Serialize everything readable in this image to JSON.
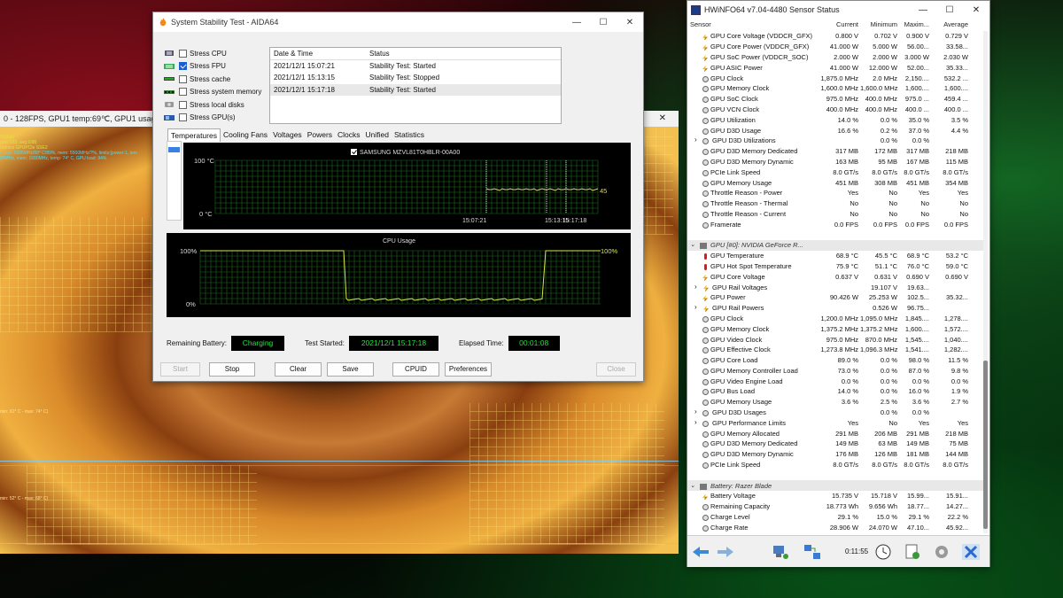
{
  "furmark": {
    "title": "0 - 128FPS, GPU1 temp:69℃, GPU1 usage:",
    "osd": [
      "MSAA)",
      "max:133, avg:108)",
      "raphics GPUPCIe SSE2",
      "- core: 1695MHz/68° C/89%, mem: 5500MHz/?%, limits:[power:1, tem",
      "88MHz, mem: 1680MHz, temp: 74° C, GPU load: 94%"
    ],
    "overlay_labels": [
      "min: 61° C - max: 74° C)",
      "min: 52° C - max: 68° C)"
    ]
  },
  "aida": {
    "title": "System Stability Test - AIDA64",
    "window_controls": [
      "—",
      "☐",
      "✕"
    ],
    "stress_items": [
      {
        "label": "Stress CPU",
        "checked": false
      },
      {
        "label": "Stress FPU",
        "checked": true
      },
      {
        "label": "Stress cache",
        "checked": false
      },
      {
        "label": "Stress system memory",
        "checked": false
      },
      {
        "label": "Stress local disks",
        "checked": false
      },
      {
        "label": "Stress GPU(s)",
        "checked": false
      }
    ],
    "log_headers": [
      "Date & Time",
      "Status"
    ],
    "log_rows": [
      {
        "time": "2021/12/1 15:07:21",
        "status": "Stability Test: Started"
      },
      {
        "time": "2021/12/1 15:13:15",
        "status": "Stability Test: Stopped"
      },
      {
        "time": "2021/12/1 15:17:18",
        "status": "Stability Test: Started"
      }
    ],
    "tabs": [
      "Temperatures",
      "Cooling Fans",
      "Voltages",
      "Powers",
      "Clocks",
      "Unified",
      "Statistics"
    ],
    "temp_graph": {
      "legend": "SAMSUNG MZVL81T0HBLR-00A00",
      "y_max_label": "100 °C",
      "y_min_label": "0 °C",
      "x_labels": [
        "15:07:21",
        "15:13:15",
        "15:17:18"
      ],
      "current_value": "45",
      "value": 45
    },
    "cpu_graph": {
      "title": "CPU Usage",
      "y_max_label": "100%",
      "y_min_label": "0%",
      "current_value": "100%"
    },
    "status": {
      "battery_label": "Remaining Battery:",
      "battery_value": "Charging",
      "started_label": "Test Started:",
      "started_value": "2021/12/1 15:17:18",
      "elapsed_label": "Elapsed Time:",
      "elapsed_value": "00:01:08"
    },
    "buttons": {
      "start": "Start",
      "stop": "Stop",
      "clear": "Clear",
      "save": "Save",
      "cpuid": "CPUID",
      "preferences": "Preferences",
      "close": "Close"
    }
  },
  "hwinfo": {
    "title": "HWiNFO64 v7.04-4480 Sensor Status",
    "window_controls": [
      "—",
      "☐",
      "✕"
    ],
    "headers": [
      "Sensor",
      "Current",
      "Minimum",
      "Maxim...",
      "Average"
    ],
    "rows": [
      {
        "icon": "bolt",
        "name": "GPU Core Voltage (VDDCR_GFX)",
        "cur": "0.800 V",
        "min": "0.702 V",
        "max": "0.900 V",
        "avg": "0.729 V"
      },
      {
        "icon": "bolt",
        "name": "GPU Core Power (VDDCR_GFX)",
        "cur": "41.000 W",
        "min": "5.000 W",
        "max": "56.00...",
        "avg": "33.58..."
      },
      {
        "icon": "bolt",
        "name": "GPU SoC Power (VDDCR_SOC)",
        "cur": "2.000 W",
        "min": "2.000 W",
        "max": "3.000 W",
        "avg": "2.030 W"
      },
      {
        "icon": "bolt",
        "name": "GPU ASIC Power",
        "cur": "41.000 W",
        "min": "12.000 W",
        "max": "52.00...",
        "avg": "35.33..."
      },
      {
        "icon": "circle",
        "name": "GPU Clock",
        "cur": "1,875.0 MHz",
        "min": "2.0 MHz",
        "max": "2,150....",
        "avg": "532.2 ..."
      },
      {
        "icon": "circle",
        "name": "GPU Memory Clock",
        "cur": "1,600.0 MHz",
        "min": "1,600.0 MHz",
        "max": "1,600....",
        "avg": "1,600...."
      },
      {
        "icon": "circle",
        "name": "GPU SoC Clock",
        "cur": "975.0 MHz",
        "min": "400.0 MHz",
        "max": "975.0 ...",
        "avg": "459.4 ..."
      },
      {
        "icon": "circle",
        "name": "GPU VCN Clock",
        "cur": "400.0 MHz",
        "min": "400.0 MHz",
        "max": "400.0 ...",
        "avg": "400.0 ..."
      },
      {
        "icon": "circle",
        "name": "GPU Utilization",
        "cur": "14.0 %",
        "min": "0.0 %",
        "max": "35.0 %",
        "avg": "3.5 %"
      },
      {
        "icon": "circle",
        "name": "GPU D3D Usage",
        "cur": "16.6 %",
        "min": "0.2 %",
        "max": "37.0 %",
        "avg": "4.4 %"
      },
      {
        "icon": "expand",
        "name": "GPU D3D Utilizations",
        "cur": "",
        "min": "0.0 %",
        "max": "0.0 %",
        "avg": ""
      },
      {
        "icon": "circle",
        "name": "GPU D3D Memory Dedicated",
        "cur": "317 MB",
        "min": "172 MB",
        "max": "317 MB",
        "avg": "218 MB"
      },
      {
        "icon": "circle",
        "name": "GPU D3D Memory Dynamic",
        "cur": "163 MB",
        "min": "95 MB",
        "max": "167 MB",
        "avg": "115 MB"
      },
      {
        "icon": "circle",
        "name": "PCIe Link Speed",
        "cur": "8.0 GT/s",
        "min": "8.0 GT/s",
        "max": "8.0 GT/s",
        "avg": "8.0 GT/s"
      },
      {
        "icon": "circle",
        "name": "GPU Memory Usage",
        "cur": "451 MB",
        "min": "308 MB",
        "max": "451 MB",
        "avg": "354 MB"
      },
      {
        "icon": "circle",
        "name": "Throttle Reason - Power",
        "cur": "Yes",
        "min": "No",
        "max": "Yes",
        "avg": "Yes"
      },
      {
        "icon": "circle",
        "name": "Throttle Reason - Thermal",
        "cur": "No",
        "min": "No",
        "max": "No",
        "avg": "No"
      },
      {
        "icon": "circle",
        "name": "Throttle Reason - Current",
        "cur": "No",
        "min": "No",
        "max": "No",
        "avg": "No"
      },
      {
        "icon": "circle",
        "name": "Framerate",
        "cur": "0.0 FPS",
        "min": "0.0 FPS",
        "max": "0.0 FPS",
        "avg": "0.0 FPS"
      },
      {
        "icon": "spacer",
        "name": "",
        "cur": "",
        "min": "",
        "max": "",
        "avg": ""
      },
      {
        "icon": "group",
        "name": "GPU [#0]: NVIDIA GeForce R...",
        "cur": "",
        "min": "",
        "max": "",
        "avg": ""
      },
      {
        "icon": "therm",
        "name": "GPU Temperature",
        "cur": "68.9 °C",
        "min": "45.5 °C",
        "max": "68.9 °C",
        "avg": "53.2 °C"
      },
      {
        "icon": "therm",
        "name": "GPU Hot Spot Temperature",
        "cur": "75.9 °C",
        "min": "51.1 °C",
        "max": "76.0 °C",
        "avg": "59.0 °C"
      },
      {
        "icon": "bolt",
        "name": "GPU Core Voltage",
        "cur": "0.637 V",
        "min": "0.631 V",
        "max": "0.690 V",
        "avg": "0.690 V"
      },
      {
        "icon": "expand-bolt",
        "name": "GPU Rail Voltages",
        "cur": "",
        "min": "19.107 V",
        "max": "19.63...",
        "avg": ""
      },
      {
        "icon": "bolt",
        "name": "GPU Power",
        "cur": "90.426 W",
        "min": "25.253 W",
        "max": "102.5...",
        "avg": "35.32..."
      },
      {
        "icon": "expand-bolt",
        "name": "GPU Rail Powers",
        "cur": "",
        "min": "0.526 W",
        "max": "96.75...",
        "avg": ""
      },
      {
        "icon": "circle",
        "name": "GPU Clock",
        "cur": "1,200.0 MHz",
        "min": "1,095.0 MHz",
        "max": "1,845....",
        "avg": "1,278...."
      },
      {
        "icon": "circle",
        "name": "GPU Memory Clock",
        "cur": "1,375.2 MHz",
        "min": "1,375.2 MHz",
        "max": "1,600....",
        "avg": "1,572...."
      },
      {
        "icon": "circle",
        "name": "GPU Video Clock",
        "cur": "975.0 MHz",
        "min": "870.0 MHz",
        "max": "1,545....",
        "avg": "1,040...."
      },
      {
        "icon": "circle",
        "name": "GPU Effective Clock",
        "cur": "1,273.8 MHz",
        "min": "1,096.3 MHz",
        "max": "1,541....",
        "avg": "1,282...."
      },
      {
        "icon": "circle",
        "name": "GPU Core Load",
        "cur": "89.0 %",
        "min": "0.0 %",
        "max": "98.0 %",
        "avg": "11.5 %"
      },
      {
        "icon": "circle",
        "name": "GPU Memory Controller Load",
        "cur": "73.0 %",
        "min": "0.0 %",
        "max": "87.0 %",
        "avg": "9.8 %"
      },
      {
        "icon": "circle",
        "name": "GPU Video Engine Load",
        "cur": "0.0 %",
        "min": "0.0 %",
        "max": "0.0 %",
        "avg": "0.0 %"
      },
      {
        "icon": "circle",
        "name": "GPU Bus Load",
        "cur": "14.0 %",
        "min": "0.0 %",
        "max": "16.0 %",
        "avg": "1.9 %"
      },
      {
        "icon": "circle",
        "name": "GPU Memory Usage",
        "cur": "3.6 %",
        "min": "2.5 %",
        "max": "3.6 %",
        "avg": "2.7 %"
      },
      {
        "icon": "expand",
        "name": "GPU D3D Usages",
        "cur": "",
        "min": "0.0 %",
        "max": "0.0 %",
        "avg": ""
      },
      {
        "icon": "expand",
        "name": "GPU Performance Limits",
        "cur": "Yes",
        "min": "No",
        "max": "Yes",
        "avg": "Yes"
      },
      {
        "icon": "circle",
        "name": "GPU Memory Allocated",
        "cur": "291 MB",
        "min": "206 MB",
        "max": "291 MB",
        "avg": "218 MB"
      },
      {
        "icon": "circle",
        "name": "GPU D3D Memory Dedicated",
        "cur": "149 MB",
        "min": "63 MB",
        "max": "149 MB",
        "avg": "75 MB"
      },
      {
        "icon": "circle",
        "name": "GPU D3D Memory Dynamic",
        "cur": "176 MB",
        "min": "126 MB",
        "max": "181 MB",
        "avg": "144 MB"
      },
      {
        "icon": "circle",
        "name": "PCIe Link Speed",
        "cur": "8.0 GT/s",
        "min": "8.0 GT/s",
        "max": "8.0 GT/s",
        "avg": "8.0 GT/s"
      },
      {
        "icon": "spacer",
        "name": "",
        "cur": "",
        "min": "",
        "max": "",
        "avg": ""
      },
      {
        "icon": "group",
        "name": "Battery: Razer Blade",
        "cur": "",
        "min": "",
        "max": "",
        "avg": ""
      },
      {
        "icon": "bolt",
        "name": "Battery Voltage",
        "cur": "15.735 V",
        "min": "15.718 V",
        "max": "15.99...",
        "avg": "15.91..."
      },
      {
        "icon": "circle",
        "name": "Remaining Capacity",
        "cur": "18.773 Wh",
        "min": "9.656 Wh",
        "max": "18.77...",
        "avg": "14.27..."
      },
      {
        "icon": "circle",
        "name": "Charge Level",
        "cur": "29.1 %",
        "min": "15.0 %",
        "max": "29.1 %",
        "avg": "22.2 %"
      },
      {
        "icon": "circle",
        "name": "Charge Rate",
        "cur": "28.906 W",
        "min": "24.070 W",
        "max": "47.10...",
        "avg": "45.92..."
      },
      {
        "icon": "circle",
        "name": "Wear Level",
        "cur": "0.0 %",
        "min": "0.0 %",
        "max": "0.0 %",
        "avg": "0.0 %"
      }
    ],
    "elapsed": "0:11:55"
  }
}
